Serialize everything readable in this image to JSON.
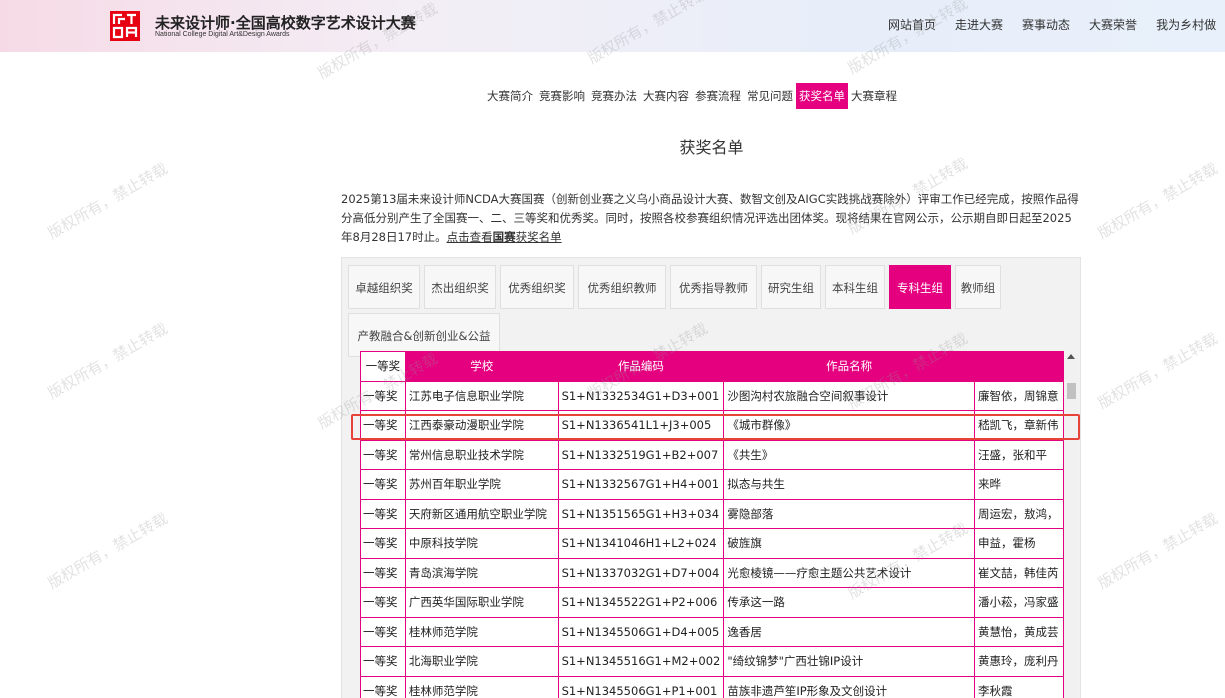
{
  "header": {
    "logo_title": "未来设计师·全国高校数字艺术设计大赛",
    "logo_subtitle": "National College Digital Art&Design Awards",
    "nav": [
      "网站首页",
      "走进大赛",
      "赛事动态",
      "大赛荣誉",
      "我为乡村做"
    ]
  },
  "subnav": {
    "items": [
      "大赛简介",
      "竞赛影响",
      "竞赛办法",
      "大赛内容",
      "参赛流程",
      "常见问题",
      "获奖名单",
      "大赛章程"
    ],
    "active_index": 6
  },
  "page_title": "获奖名单",
  "intro": {
    "text": "2025第13届未来设计师NCDA大赛国赛（创新创业赛之义乌小商品设计大赛、数智文创及AIGC实践挑战赛除外）评审工作已经完成，按照作品得分高低分别产生了全国赛一、二、三等奖和优秀奖。同时，按照各校参赛组织情况评选出团体奖。现将结果在官网公示，公示期自即日起至2025年8月28日17时止。",
    "link_prefix": "点击查看",
    "link_bold": "国赛",
    "link_suffix": "获奖名单"
  },
  "tabs": {
    "items": [
      "卓越组织奖",
      "杰出组织奖",
      "优秀组织奖",
      "优秀组织教师",
      "优秀指导教师",
      "研究生组",
      "本科生组",
      "专科生组",
      "教师组",
      "产教融合&创新创业&公益"
    ],
    "active_index": 7
  },
  "table": {
    "header_prize": "一等奖",
    "columns": [
      "学校",
      "作品编码",
      "作品名称",
      ""
    ],
    "rows": [
      {
        "prize": "一等奖",
        "school": "江苏电子信息职业学院",
        "code": "S1+N1332534G1+D3+001",
        "title": "沙图沟村农旅融合空间叙事设计",
        "authors": "廉智依，周锦意"
      },
      {
        "prize": "一等奖",
        "school": "江西泰豪动漫职业学院",
        "code": "S1+N1336541L1+J3+005",
        "title": "《城市群像》",
        "authors": "嵇凯飞，章新伟"
      },
      {
        "prize": "一等奖",
        "school": "常州信息职业技术学院",
        "code": "S1+N1332519G1+B2+007",
        "title": "《共生》",
        "authors": "汪盛，张和平"
      },
      {
        "prize": "一等奖",
        "school": "苏州百年职业学院",
        "code": "S1+N1332567G1+H4+001",
        "title": "拟态与共生",
        "authors": "来晔"
      },
      {
        "prize": "一等奖",
        "school": "天府新区通用航空职业学院",
        "code": "S1+N1351565G1+H3+034",
        "title": "雾隐部落",
        "authors": "周运宏，敖鸿，"
      },
      {
        "prize": "一等奖",
        "school": "中原科技学院",
        "code": "S1+N1341046H1+L2+024",
        "title": "破旌旗",
        "authors": "申益，霍杨"
      },
      {
        "prize": "一等奖",
        "school": "青岛滨海学院",
        "code": "S1+N1337032G1+D7+004",
        "title": "光愈棱镜——疗愈主题公共艺术设计",
        "authors": "崔文喆，韩佳芮"
      },
      {
        "prize": "一等奖",
        "school": "广西英华国际职业学院",
        "code": "S1+N1345522G1+P2+006",
        "title": "传承这一路",
        "authors": "潘小菘，冯家盛"
      },
      {
        "prize": "一等奖",
        "school": "桂林师范学院",
        "code": "S1+N1345506G1+D4+005",
        "title": "逸香居",
        "authors": "黄慧怡，黄成芸"
      },
      {
        "prize": "一等奖",
        "school": "北海职业学院",
        "code": "S1+N1345516G1+M2+002",
        "title": "\"绮纹锦梦\"广西壮锦IP设计",
        "authors": "黄惠玲，庞利丹"
      },
      {
        "prize": "一等奖",
        "school": "桂林师范学院",
        "code": "S1+N1345506G1+P1+001",
        "title": "苗族非遗芦笙IP形象及文创设计",
        "authors": "李秋霞"
      }
    ]
  },
  "watermark": "版权所有，禁止转载",
  "colors": {
    "accent": "#e4007f",
    "logo_red": "#e60012",
    "highlight": "#e8433a"
  }
}
